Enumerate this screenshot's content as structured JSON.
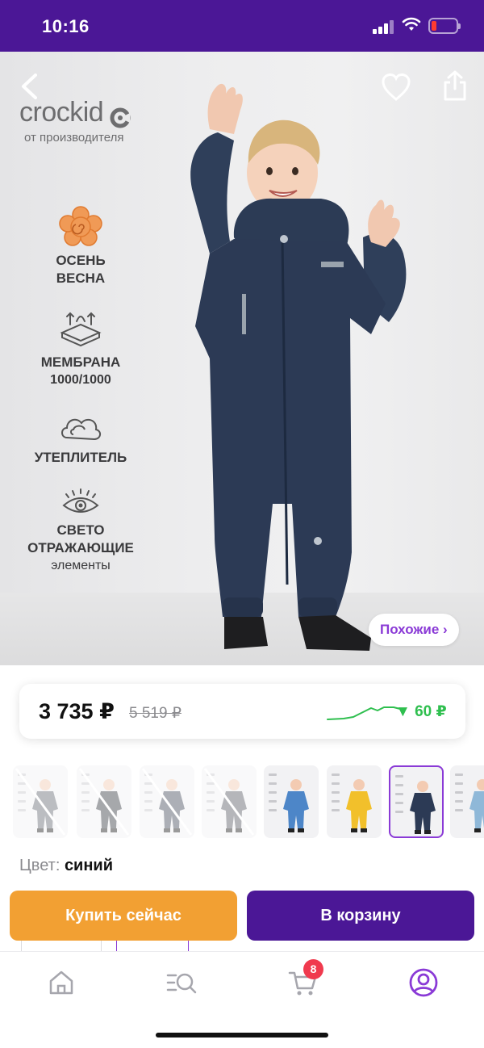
{
  "status_bar": {
    "time": "10:16"
  },
  "hero": {
    "brand_name": "crockid",
    "brand_sub": "от производителя",
    "features": [
      {
        "lines": [
          "ОСЕНЬ",
          "ВЕСНА"
        ],
        "icon": "flower-icon"
      },
      {
        "lines": [
          "МЕМБРАНА",
          "1000/1000"
        ],
        "icon": "membrane-icon"
      },
      {
        "lines": [
          "УТЕПЛИТЕЛЬ"
        ],
        "icon": "cloud-icon"
      },
      {
        "lines": [
          "СВЕТО",
          "ОТРАЖАЮЩИЕ"
        ],
        "sub": "элементы",
        "icon": "eye-icon"
      }
    ],
    "similar_label": "Похожие ›"
  },
  "price": {
    "current": "3 735 ₽",
    "old": "5 519 ₽",
    "change": "60 ₽",
    "change_direction": "down",
    "change_color": "#2fbf4f"
  },
  "thumbnails": [
    {
      "available": false,
      "suit_color": "#6b6f78"
    },
    {
      "available": false,
      "suit_color": "#3c3f46"
    },
    {
      "available": false,
      "suit_color": "#4a5060"
    },
    {
      "available": false,
      "suit_color": "#5c6068"
    },
    {
      "available": true,
      "suit_color": "#4d86c8"
    },
    {
      "available": true,
      "suit_color": "#f2c02b"
    },
    {
      "available": true,
      "selected": true,
      "suit_color": "#2c3a55"
    },
    {
      "available": true,
      "suit_color": "#8fb8d8"
    }
  ],
  "color": {
    "label": "Цвет:",
    "value": "синий"
  },
  "actions": {
    "buy_now": "Купить сейчас",
    "add_to_cart": "В корзину"
  },
  "tabbar": {
    "items": [
      "home",
      "catalog-search",
      "cart",
      "profile"
    ],
    "cart_count": "8",
    "active": "profile",
    "accent": "#8a3ad6"
  },
  "colors": {
    "brand": "#4b1796",
    "accent_orange": "#f2a033"
  }
}
